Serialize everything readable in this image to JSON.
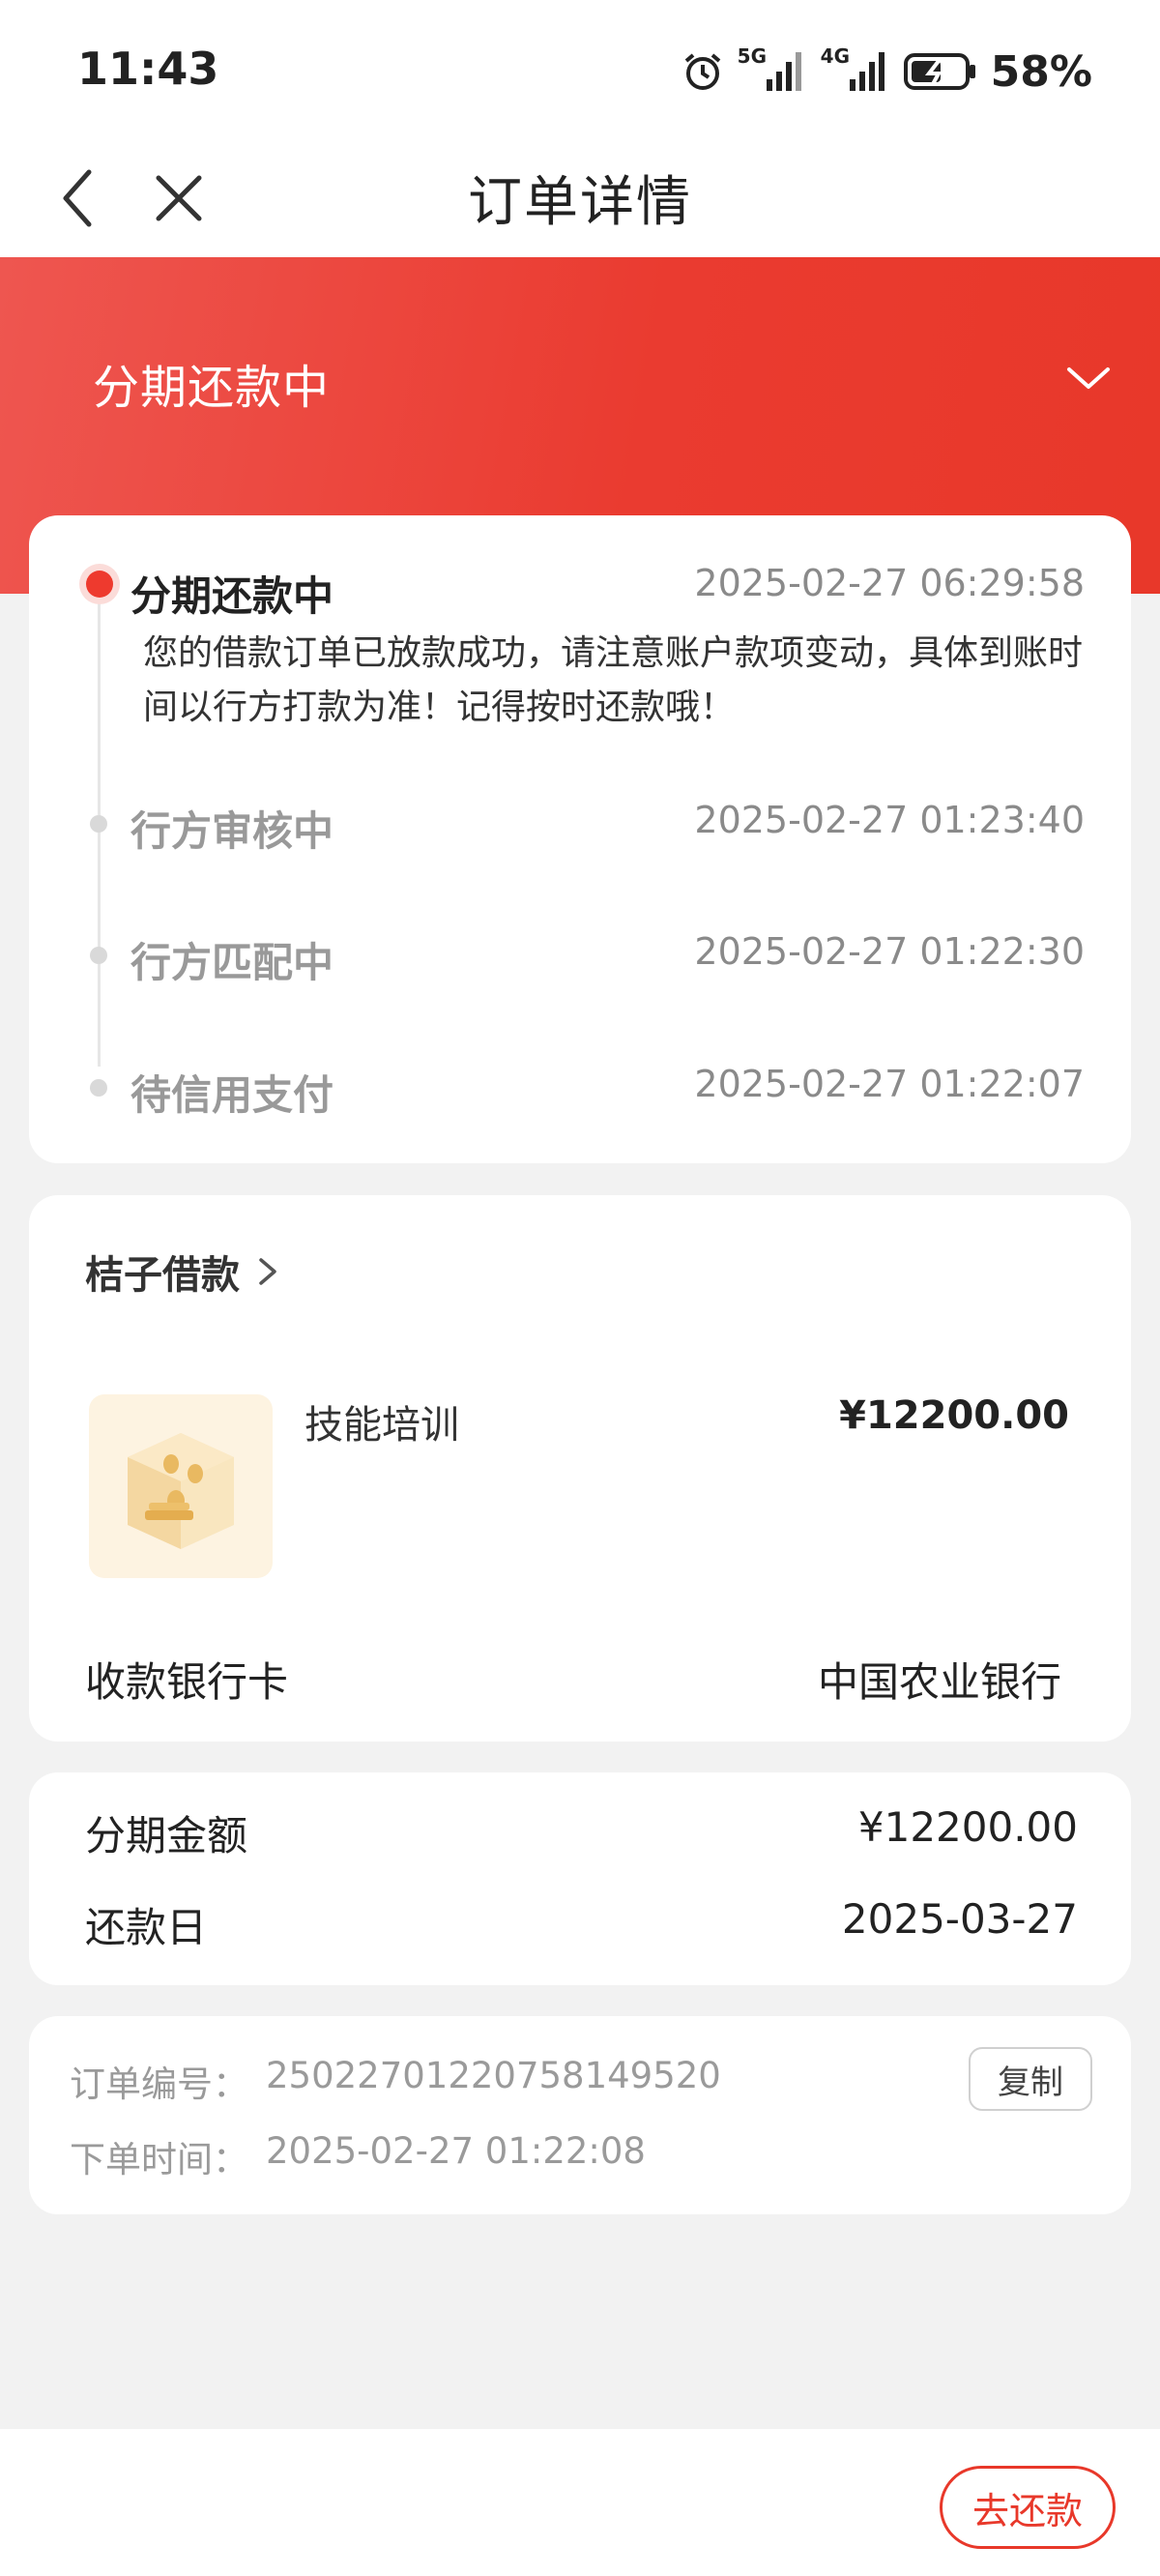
{
  "status_bar": {
    "time": "11:43",
    "signal_5g": "5G",
    "signal_4g": "4G",
    "battery": "58%"
  },
  "nav": {
    "title": "订单详情"
  },
  "banner": {
    "status_title": "分期还款中"
  },
  "timeline": [
    {
      "title": "分期还款中",
      "time": "2025-02-27 06:29:58",
      "desc": "您的借款订单已放款成功，请注意账户款项变动，具体到账时间以行方打款为准！记得按时还款哦！"
    },
    {
      "title": "行方审核中",
      "time": "2025-02-27 01:23:40"
    },
    {
      "title": "行方匹配中",
      "time": "2025-02-27 01:22:30"
    },
    {
      "title": "待信用支付",
      "time": "2025-02-27 01:22:07"
    }
  ],
  "product": {
    "merchant": "桔子借款",
    "name": "技能培训",
    "price": "¥12200.00",
    "bank_label": "收款银行卡",
    "bank_value": "中国农业银行"
  },
  "installment": {
    "amount_label": "分期金额",
    "amount_value": "¥12200.00",
    "due_label": "还款日",
    "due_value": "2025-03-27"
  },
  "order": {
    "number_label": "订单编号：",
    "number_value": "2502270122075814952​0",
    "time_label": "下单时间：",
    "time_value": "2025-02-27 01:22:08",
    "copy_label": "复制"
  },
  "bottom": {
    "repay_label": "去还款"
  },
  "colors": {
    "accent": "#e8382a",
    "background": "#f2f2f2"
  }
}
